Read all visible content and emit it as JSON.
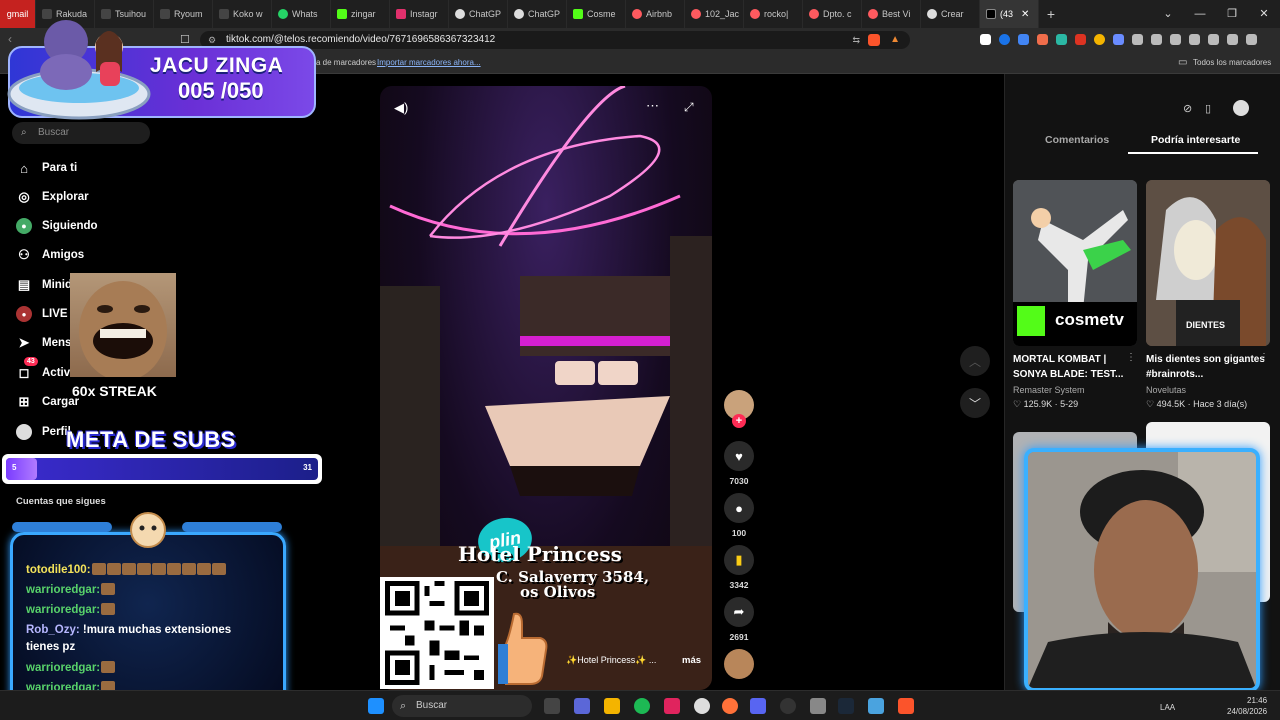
{
  "browser": {
    "tabs": [
      {
        "label": "gmail",
        "color": "#c5221f"
      },
      {
        "label": "Rakuda",
        "color": "#ffffff"
      },
      {
        "label": "Tsuihou",
        "color": "#ffffff"
      },
      {
        "label": "Ryoum",
        "color": "#ffffff"
      },
      {
        "label": "Koko w",
        "color": "#ffffff"
      },
      {
        "label": "Whats",
        "color": "#25d366"
      },
      {
        "label": "zingar",
        "color": "#53fc18"
      },
      {
        "label": "Instagr",
        "color": "#e1306c"
      },
      {
        "label": "ChatGP",
        "color": "#ffffff"
      },
      {
        "label": "ChatGP",
        "color": "#ffffff"
      },
      {
        "label": "Cosme",
        "color": "#53fc18"
      },
      {
        "label": "Airbnb",
        "color": "#ff5a5f"
      },
      {
        "label": "102_Jac",
        "color": "#ff5a5f"
      },
      {
        "label": "rocko|",
        "color": "#ff5a5f"
      },
      {
        "label": "Dpto. c",
        "color": "#ff5a5f"
      },
      {
        "label": "Best Vi",
        "color": "#ff5a5f"
      },
      {
        "label": "Crear",
        "color": "#ffffff"
      },
      {
        "label": "(43",
        "color": "#000000"
      }
    ],
    "url": "tiktok.com/@telos.recomiendo/video/7671696586367323412",
    "bookmarks_text": "a de marcadores",
    "bookmarks_link": "Importar marcadores ahora...",
    "all_bookmarks": "Todos los marcadores"
  },
  "sidebar": {
    "search_placeholder": "Buscar",
    "items": [
      {
        "label": "Para ti",
        "icon": "home-icon"
      },
      {
        "label": "Explorar",
        "icon": "compass-icon"
      },
      {
        "label": "Siguiendo",
        "icon": "following-icon"
      },
      {
        "label": "Amigos",
        "icon": "friends-icon"
      },
      {
        "label": "Minid",
        "icon": "drama-icon"
      },
      {
        "label": "LIVE",
        "icon": "live-icon"
      },
      {
        "label": "Mens",
        "icon": "messages-icon"
      },
      {
        "label": "Activi",
        "icon": "activity-icon",
        "badge": "43"
      },
      {
        "label": "Cargar",
        "icon": "upload-icon"
      },
      {
        "label": "Perfil",
        "icon": "profile-icon"
      }
    ],
    "following_label": "Cuentas que sigues"
  },
  "overlay": {
    "goal_title": "JACU ZINGA",
    "goal_count": "005 /050",
    "streak": "60x STREAK",
    "meta_title": "META DE SUBS",
    "subs_min": "5",
    "subs_max": "31",
    "subs_progress": 0.1,
    "plin": "plin"
  },
  "chat": [
    {
      "user": "totodile100:",
      "msg": "",
      "emotes": 9
    },
    {
      "user": "warrioredgar:",
      "msg": "",
      "emotes": 1
    },
    {
      "user": "warrioredgar:",
      "msg": "",
      "emotes": 1
    },
    {
      "user": "Rob_Ozy:",
      "msg": "!mura muchas extensiones",
      "emotes": 0
    },
    {
      "user": "",
      "msg": "tienes pz",
      "emotes": 0
    },
    {
      "user": "warrioredgar:",
      "msg": "",
      "emotes": 1
    },
    {
      "user": "warrioredgar:",
      "msg": "",
      "emotes": 1
    }
  ],
  "video": {
    "title": "Hotel Princess",
    "addr1": "C. Salaverry 3584,",
    "addr2": "os Olivos",
    "caption": "✨Hotel Princess✨ ...",
    "more": "más",
    "likes": "7030",
    "comments": "100",
    "saves": "3342",
    "shares": "2691"
  },
  "right_panel": {
    "tab_comments": "Comentarios",
    "tab_interest": "Podría interesarte",
    "recs": [
      {
        "title": "MORTAL KOMBAT | SONYA BLADE: TEST...",
        "author": "Remaster System",
        "likes": "125.9K",
        "date": "5-29",
        "badge": "cosmetv"
      },
      {
        "title": "Mis dientes son gigantes #brainrots...",
        "author": "Novelutas",
        "likes": "494.5K",
        "date": "Hace 3 día(s)",
        "badge": "DIENTES"
      }
    ]
  },
  "taskbar": {
    "search": "Buscar",
    "lang": "LAA",
    "time": "21:46",
    "date": "24/08/2026"
  }
}
